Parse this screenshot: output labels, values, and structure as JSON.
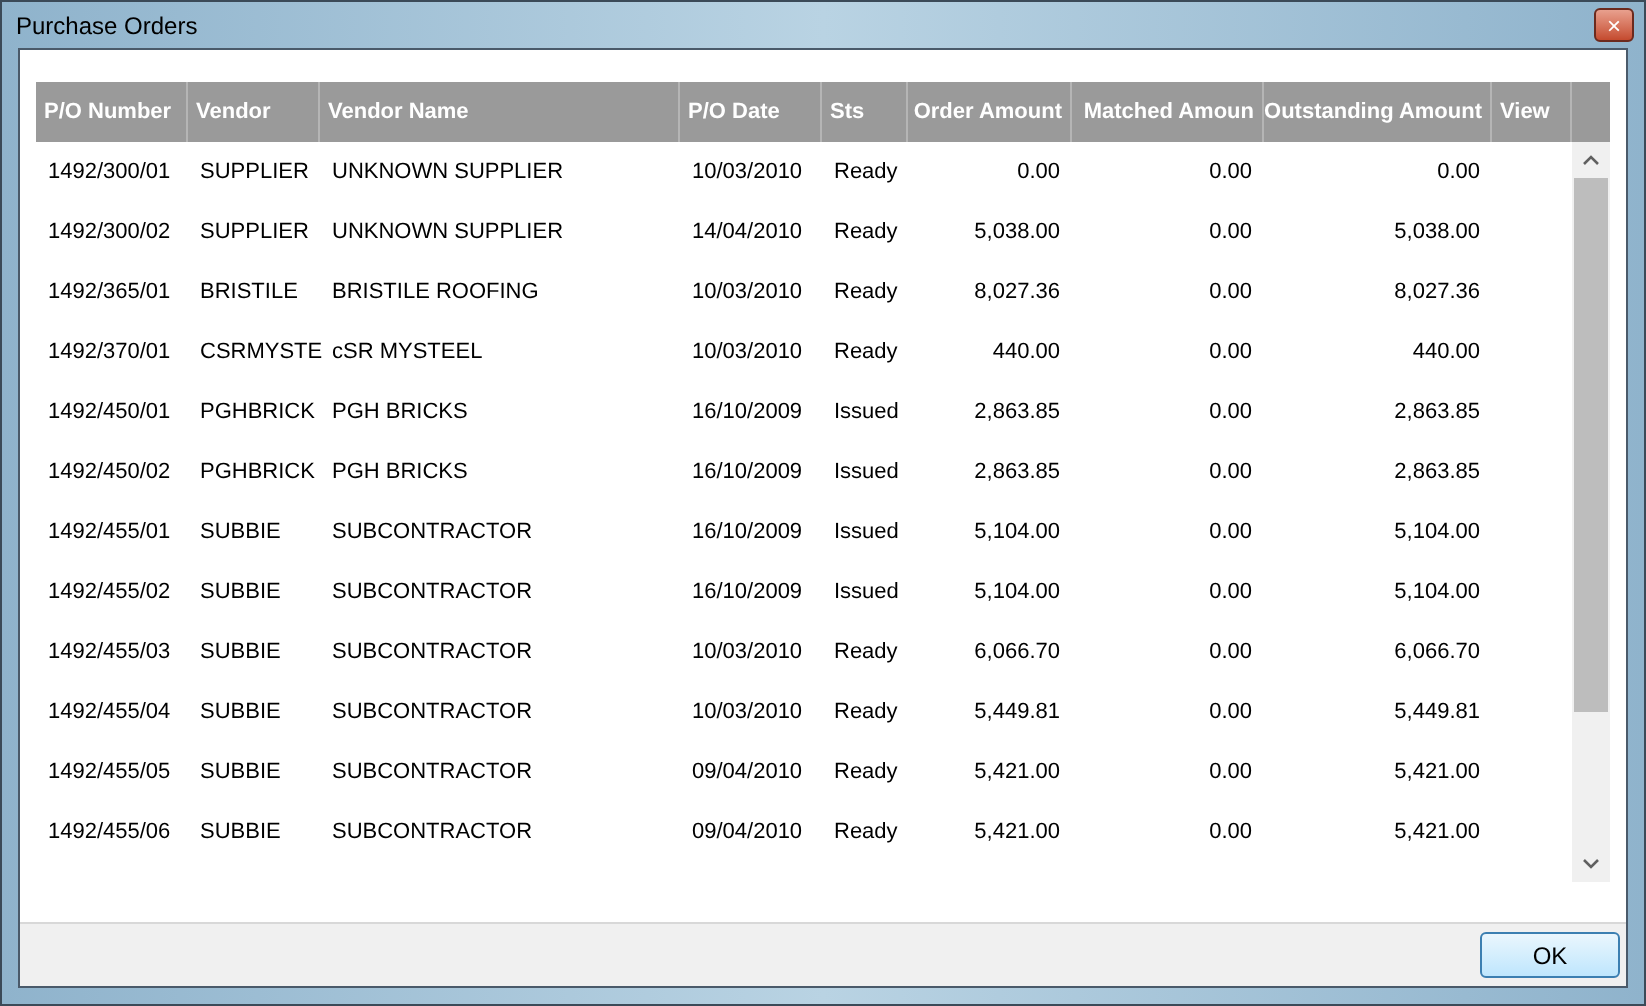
{
  "window": {
    "title": "Purchase Orders",
    "close": "×"
  },
  "table": {
    "columns": [
      "P/O Number",
      "Vendor",
      "Vendor Name",
      "P/O Date",
      "Sts",
      "Order Amount",
      "Matched Amoun",
      "Outstanding Amount",
      "View"
    ],
    "rows": [
      [
        "1492/300/01",
        "SUPPLIER",
        "UNKNOWN SUPPLIER",
        "10/03/2010",
        "Ready",
        "0.00",
        "0.00",
        "0.00"
      ],
      [
        "1492/300/02",
        "SUPPLIER",
        "UNKNOWN SUPPLIER",
        "14/04/2010",
        "Ready",
        "5,038.00",
        "0.00",
        "5,038.00"
      ],
      [
        "1492/365/01",
        "BRISTILE",
        "BRISTILE ROOFING",
        "10/03/2010",
        "Ready",
        "8,027.36",
        "0.00",
        "8,027.36"
      ],
      [
        "1492/370/01",
        "CSRMYSTE",
        "cSR MYSTEEL",
        "10/03/2010",
        "Ready",
        "440.00",
        "0.00",
        "440.00"
      ],
      [
        "1492/450/01",
        "PGHBRICK",
        "PGH BRICKS",
        "16/10/2009",
        "Issued",
        "2,863.85",
        "0.00",
        "2,863.85"
      ],
      [
        "1492/450/02",
        "PGHBRICK",
        "PGH BRICKS",
        "16/10/2009",
        "Issued",
        "2,863.85",
        "0.00",
        "2,863.85"
      ],
      [
        "1492/455/01",
        "SUBBIE",
        "SUBCONTRACTOR",
        "16/10/2009",
        "Issued",
        "5,104.00",
        "0.00",
        "5,104.00"
      ],
      [
        "1492/455/02",
        "SUBBIE",
        "SUBCONTRACTOR",
        "16/10/2009",
        "Issued",
        "5,104.00",
        "0.00",
        "5,104.00"
      ],
      [
        "1492/455/03",
        "SUBBIE",
        "SUBCONTRACTOR",
        "10/03/2010",
        "Ready",
        "6,066.70",
        "0.00",
        "6,066.70"
      ],
      [
        "1492/455/04",
        "SUBBIE",
        "SUBCONTRACTOR",
        "10/03/2010",
        "Ready",
        "5,449.81",
        "0.00",
        "5,449.81"
      ],
      [
        "1492/455/05",
        "SUBBIE",
        "SUBCONTRACTOR",
        "09/04/2010",
        "Ready",
        "5,421.00",
        "0.00",
        "5,421.00"
      ],
      [
        "1492/455/06",
        "SUBBIE",
        "SUBCONTRACTOR",
        "09/04/2010",
        "Ready",
        "5,421.00",
        "0.00",
        "5,421.00"
      ]
    ]
  },
  "buttons": [
    "OK"
  ]
}
